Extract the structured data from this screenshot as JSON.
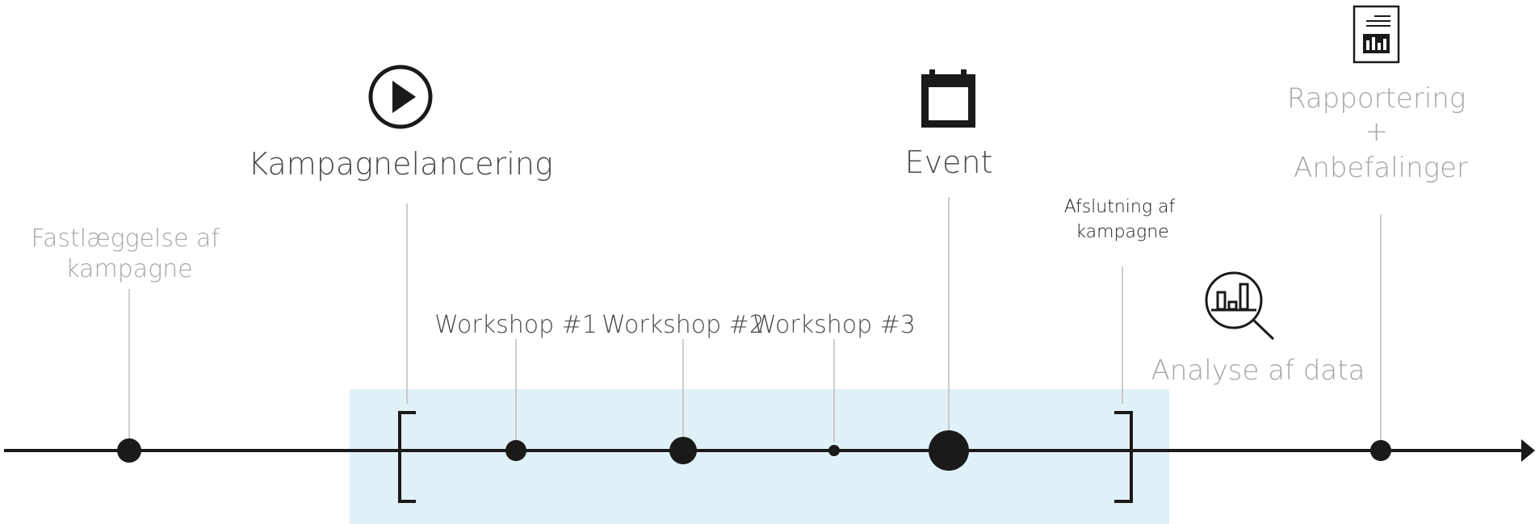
{
  "colors": {
    "line": "#1a1a1a",
    "highlight": "#e1f1f8",
    "label_dark": "#4a4a4a",
    "label_light": "#a6a6a6",
    "connector": "#bdbdbd"
  },
  "labels": {
    "fastlaeggelse": [
      "Fastlæggelse af",
      "kampagne"
    ],
    "kampagnelancering": "Kampagnelancering",
    "workshop1": "Workshop #1",
    "workshop2": "Workshop #2",
    "workshop3": "Workshop #3",
    "event": "Event",
    "afslutning": [
      "Afslutning af",
      "kampagne"
    ],
    "analyse": "Analyse af data",
    "rapportering": [
      "Rapportering",
      "+",
      "Anbefalinger"
    ]
  },
  "icons": {
    "kampagnelancering": "play-icon",
    "event": "calendar-icon",
    "analyse": "magnifier-chart-icon",
    "rapportering": "report-icon"
  }
}
